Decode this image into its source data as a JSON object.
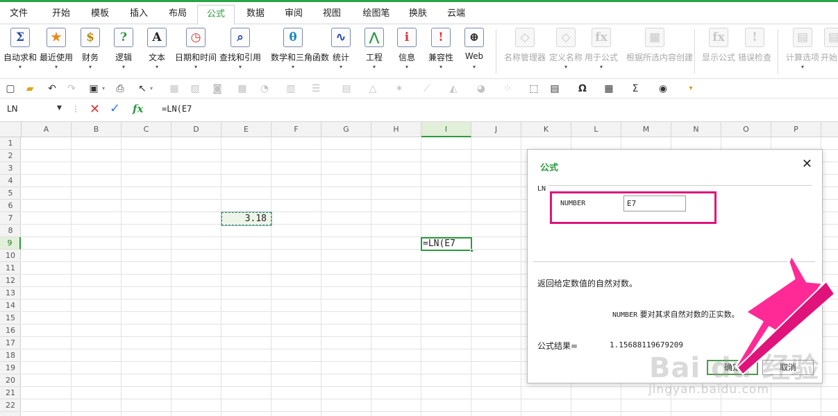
{
  "menu": {
    "tabs": [
      {
        "label": "文件"
      },
      {
        "label": "开始"
      },
      {
        "label": "模板"
      },
      {
        "label": "插入"
      },
      {
        "label": "布局"
      },
      {
        "label": "公式"
      },
      {
        "label": "数据"
      },
      {
        "label": "审阅"
      },
      {
        "label": "视图"
      },
      {
        "label": "绘图笔"
      },
      {
        "label": "换肤"
      },
      {
        "label": "云端"
      }
    ],
    "active": "公式"
  },
  "ribbon": {
    "buttons": [
      {
        "label": "自动求和",
        "icon": "sigma-icon",
        "glyph": "Σ"
      },
      {
        "label": "最近使用",
        "icon": "star-icon",
        "glyph": "★"
      },
      {
        "label": "财务",
        "icon": "money-bag-icon",
        "glyph": "$"
      },
      {
        "label": "逻辑",
        "icon": "question-icon",
        "glyph": "?"
      },
      {
        "label": "文本",
        "icon": "text-a-icon",
        "glyph": "A"
      },
      {
        "label": "日期和时间",
        "icon": "clock-icon",
        "glyph": "◷"
      },
      {
        "label": "查找和引用",
        "icon": "magnifier-icon",
        "glyph": "⌕"
      },
      {
        "label": "数学和三角函数",
        "icon": "theta-icon",
        "glyph": "θ"
      },
      {
        "label": "统计",
        "icon": "line-chart-icon",
        "glyph": "∿"
      },
      {
        "label": "工程",
        "icon": "compass-icon",
        "glyph": "⋀"
      },
      {
        "label": "信息",
        "icon": "info-icon",
        "glyph": "i"
      },
      {
        "label": "兼容性",
        "icon": "warning-icon",
        "glyph": "!"
      },
      {
        "label": "Web",
        "icon": "globe-icon",
        "glyph": "⊕"
      }
    ],
    "disabled_buttons": [
      {
        "label": "名称管理器",
        "icon": "tag-icon",
        "glyph": "◇"
      },
      {
        "label": "定义名称",
        "icon": "tag-plus-icon",
        "glyph": "◇"
      },
      {
        "label": "用于公式",
        "icon": "tag-fx-icon",
        "glyph": "fx"
      },
      {
        "label": "根据所选内容创建",
        "icon": "grid-create-icon",
        "glyph": "▦"
      },
      {
        "label": "显示公式",
        "icon": "show-formula-icon",
        "glyph": "fx"
      },
      {
        "label": "错误检查",
        "icon": "error-check-icon",
        "glyph": "!"
      },
      {
        "label": "计算选项",
        "icon": "calc-options-icon",
        "glyph": "▤"
      },
      {
        "label": "开始",
        "icon": "calc-start-icon",
        "glyph": "▤"
      }
    ]
  },
  "formula_bar": {
    "name_box": "LN",
    "formula": "=LN(E7"
  },
  "grid": {
    "columns": [
      "A",
      "B",
      "C",
      "D",
      "E",
      "F",
      "G",
      "H",
      "I",
      "J",
      "K",
      "L",
      "M",
      "N",
      "O",
      "P"
    ],
    "rows": [
      "1",
      "2",
      "3",
      "4",
      "5",
      "6",
      "7",
      "8",
      "9",
      "10",
      "11",
      "12",
      "13",
      "14",
      "15",
      "16",
      "17",
      "18",
      "19",
      "20",
      "21",
      "22"
    ],
    "selected_column": "I",
    "selected_row": "9",
    "cell_e7": "3.18",
    "cell_i9": "=LN(E7"
  },
  "dialog": {
    "title": "公式",
    "function_name": "LN",
    "argument_label": "NUMBER",
    "argument_value": "E7",
    "description": "返回给定数值的自然对数。",
    "arg_desc_name": "NUMBER",
    "arg_desc_text": " 要对其求自然对数的正实数。",
    "result_label": "公式结果=",
    "result_value": "1.15688119679209",
    "ok_label": "确定",
    "cancel_label": "取消"
  },
  "watermark": {
    "logo": "Bai du 经验",
    "url": "jingyan.baidu.com"
  },
  "colors": {
    "accent": "#2aa44a",
    "highlight": "#e0137a"
  }
}
